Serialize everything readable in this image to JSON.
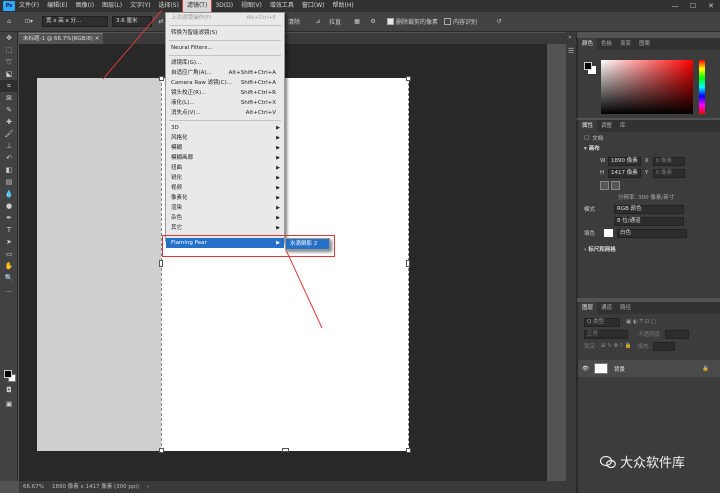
{
  "app": {
    "logo": "Ps"
  },
  "menubar": {
    "items": [
      "文件(F)",
      "编辑(E)",
      "图像(I)",
      "图层(L)",
      "文字(Y)",
      "选择(S)",
      "滤镜(T)",
      "3D(D)",
      "视图(V)",
      "增效工具",
      "窗口(W)",
      "帮助(H)"
    ],
    "active_index": 6,
    "window_controls": [
      "—",
      "☐",
      "✕"
    ]
  },
  "optbar": {
    "ratio": "宽 x 高 x 分...",
    "unit_value": "3.6 厘米",
    "clear": "清除",
    "straighten": "拉直",
    "delete_cropped": "删除裁剪的像素",
    "content_aware": "内容识别"
  },
  "doc": {
    "tab_title": "未标题-1 @ 66.7%(RGB/8)",
    "status_zoom": "66.67%",
    "status_info": "1890 像素 x 1417 像素 (300 ppi)"
  },
  "filter_menu": {
    "items": [
      {
        "label": "上次滤镜操作(F)",
        "shortcut": "Alt+Ctrl+F",
        "disabled": true
      },
      {
        "sep": true
      },
      {
        "label": "转换为智能滤镜(S)"
      },
      {
        "sep": true
      },
      {
        "label": "Neural Filters..."
      },
      {
        "sep": true
      },
      {
        "label": "滤镜库(G)..."
      },
      {
        "label": "自适应广角(A)...",
        "shortcut": "Alt+Shift+Ctrl+A"
      },
      {
        "label": "Camera Raw 滤镜(C)...",
        "shortcut": "Shift+Ctrl+A"
      },
      {
        "label": "镜头校正(R)...",
        "shortcut": "Shift+Ctrl+R"
      },
      {
        "label": "液化(L)...",
        "shortcut": "Shift+Ctrl+X"
      },
      {
        "label": "消失点(V)...",
        "shortcut": "Alt+Ctrl+V"
      },
      {
        "sep": true
      },
      {
        "label": "3D",
        "sub": true
      },
      {
        "label": "风格化",
        "sub": true
      },
      {
        "label": "模糊",
        "sub": true
      },
      {
        "label": "模糊画廊",
        "sub": true
      },
      {
        "label": "扭曲",
        "sub": true
      },
      {
        "label": "锐化",
        "sub": true
      },
      {
        "label": "视频",
        "sub": true
      },
      {
        "label": "像素化",
        "sub": true
      },
      {
        "label": "渲染",
        "sub": true
      },
      {
        "label": "杂色",
        "sub": true
      },
      {
        "label": "其它",
        "sub": true
      },
      {
        "sep": true
      },
      {
        "label": "Flaming Pear",
        "sub": true,
        "highlight": true
      }
    ],
    "submenu_label": "水滴倒影 2"
  },
  "color_panel": {
    "tabs": [
      "颜色",
      "色板",
      "渐变",
      "图案"
    ]
  },
  "props_panel": {
    "tabs": [
      "属性",
      "调整",
      "库"
    ],
    "doc_label": "文档",
    "canvas_title": "画布",
    "w_label": "W",
    "w_value": "1890 像素",
    "h_label": "H",
    "h_value": "1417 像素",
    "x_label": "X",
    "x_value": "0 像素",
    "y_label": "Y",
    "y_value": "0 像素",
    "resolution": "分辨率: 300 像素/英寸",
    "mode_label": "模式",
    "mode_value": "RGB 颜色",
    "depth_value": "8 位/通道",
    "fill_label": "填色",
    "fill_value": "白色",
    "rulers_title": "标尺和网格"
  },
  "layers_panel": {
    "tabs": [
      "图层",
      "通道",
      "路径"
    ],
    "search": "Q 类型",
    "blend": "正常",
    "opacity_label": "不透明度:",
    "lock_label": "锁定:",
    "fill_label": "填充:",
    "layer_name": "背景"
  },
  "watermark": "大众软件库"
}
